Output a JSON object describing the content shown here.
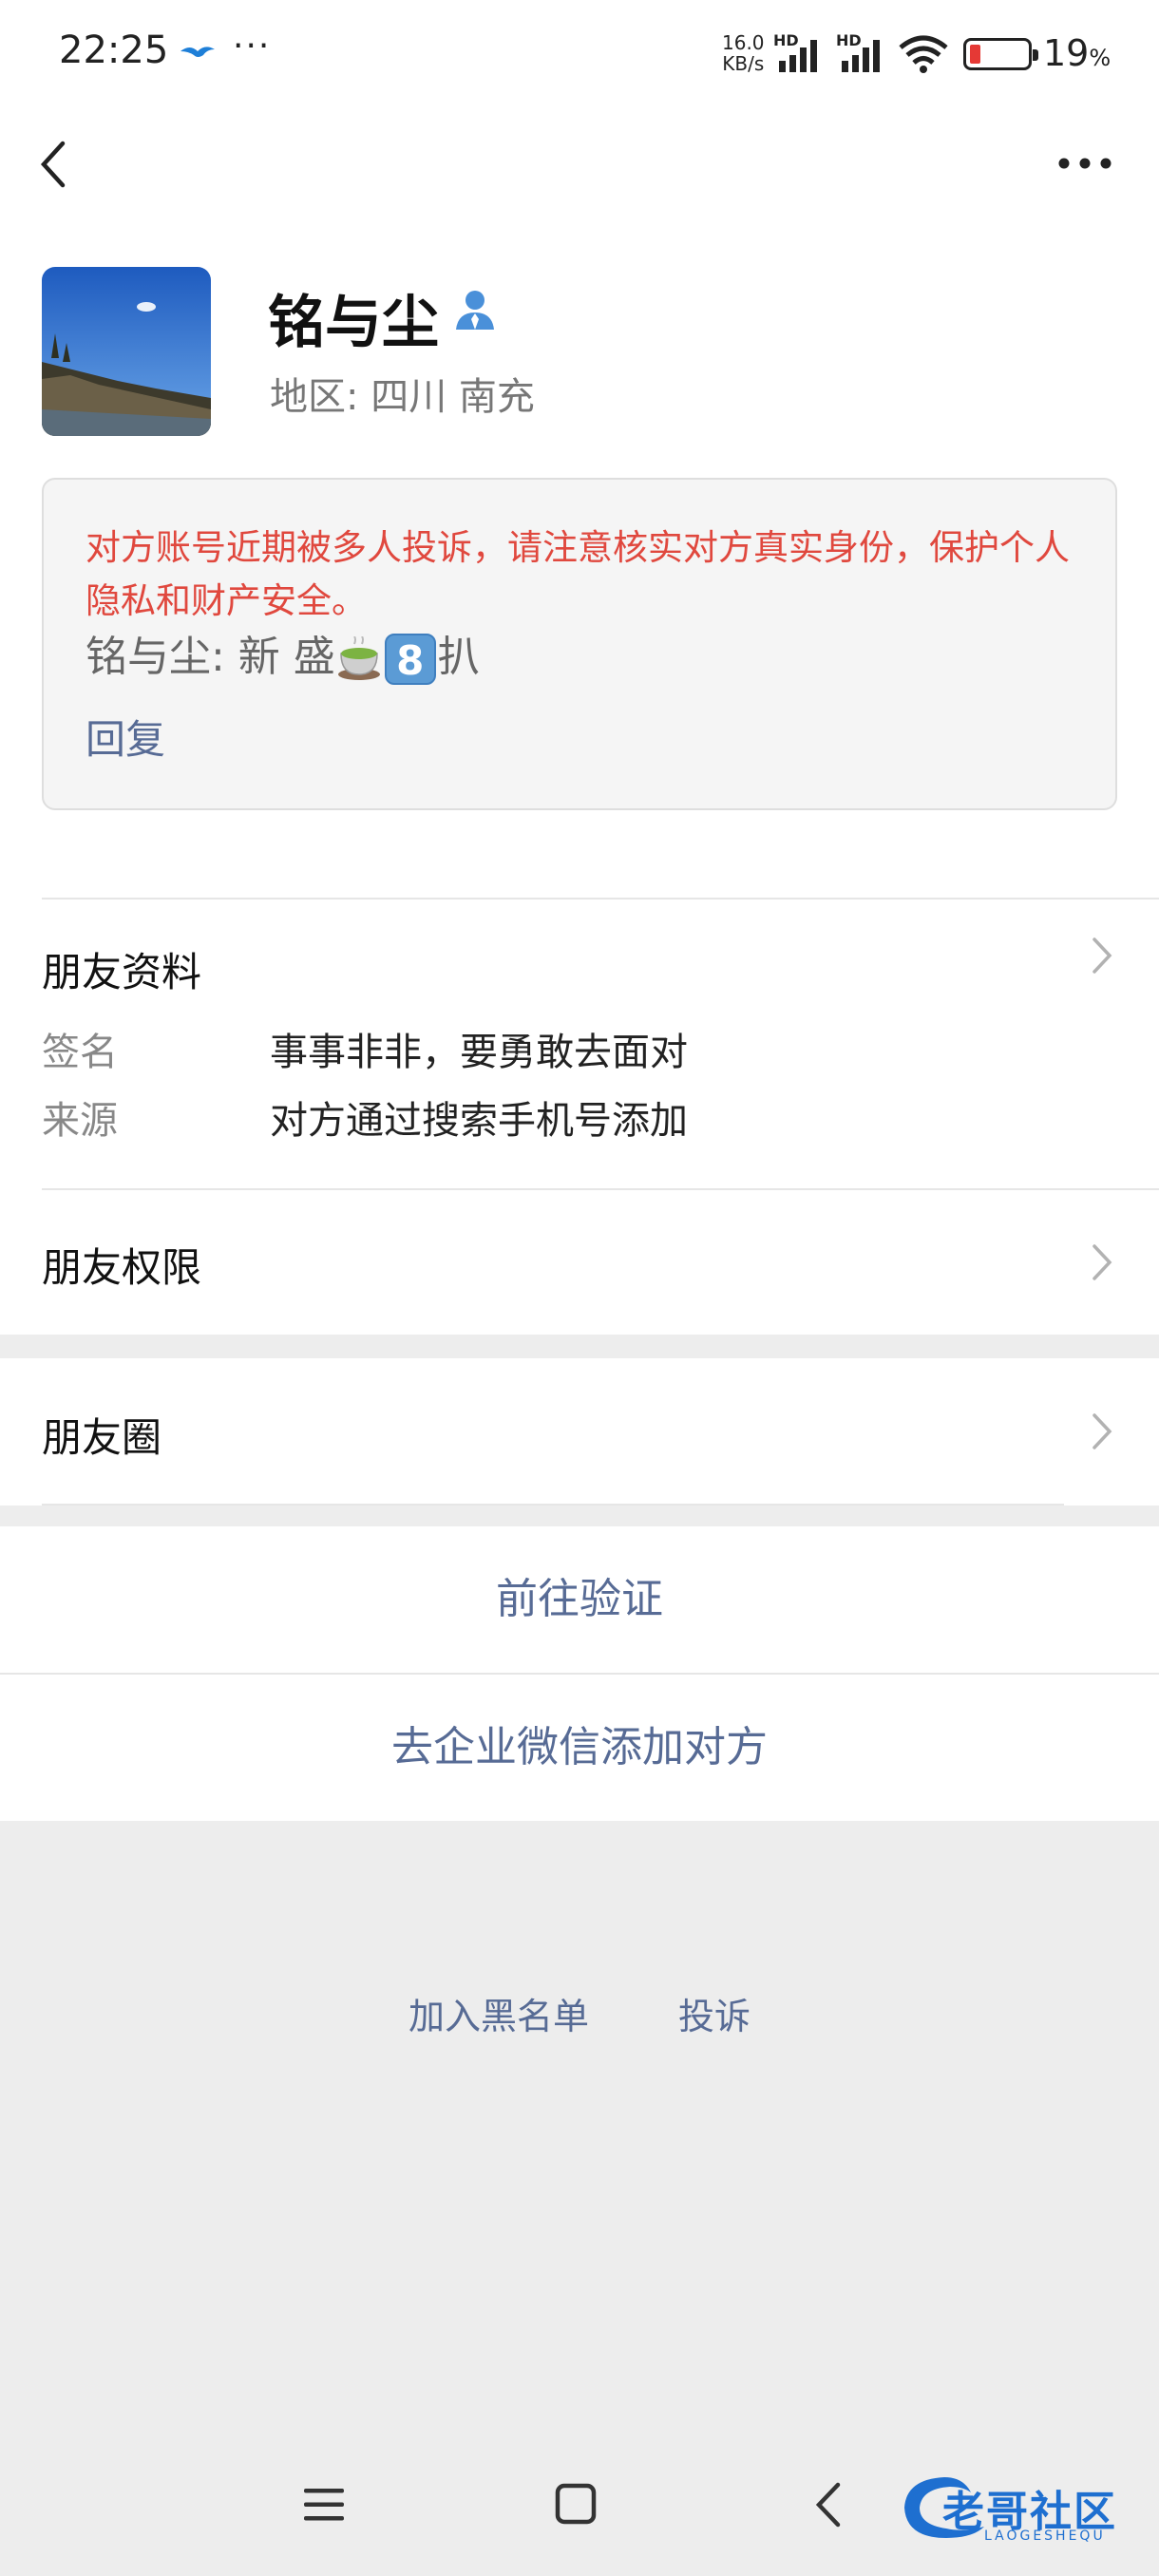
{
  "status_bar": {
    "time": "22:25",
    "net_speed_top": "16.0",
    "net_speed_unit": "KB/s",
    "hd_label_1": "HD",
    "hd_label_2": "HD",
    "battery_percent": "19",
    "battery_unit": "%",
    "battery_level": 0.19
  },
  "nav": {
    "back_icon": "chevron-left-icon",
    "more_icon": "more-dots-icon"
  },
  "profile": {
    "name": "铭与尘",
    "region": "地区:  四川  南充",
    "warning": "对方账号近期被多人投诉，请注意核实对方真实身份，保护个人隐私和财产安全。",
    "greeting_prefix": "铭与尘: 新 盛",
    "greeting_emoji_digit": "8",
    "greeting_suffix": "扒",
    "reply_label": "回复"
  },
  "friend_info": {
    "title": "朋友资料",
    "rows": [
      {
        "key": "签名",
        "value": "事事非非，要勇敢去面对"
      },
      {
        "key": "来源",
        "value": "对方通过搜索手机号添加"
      }
    ],
    "permissions_label": "朋友权限"
  },
  "moments": {
    "label": "朋友圈"
  },
  "actions": {
    "verify_label": "前往验证",
    "wecom_label": "去企业微信添加对方"
  },
  "bottom_links": {
    "blacklist_label": "加入黑名单",
    "report_label": "投诉"
  },
  "watermark": {
    "text": "老哥社区",
    "subtext": "LAOGESHEQU"
  },
  "colors": {
    "link": "#576b95",
    "warning": "#e0483e",
    "background": "#ededed"
  }
}
